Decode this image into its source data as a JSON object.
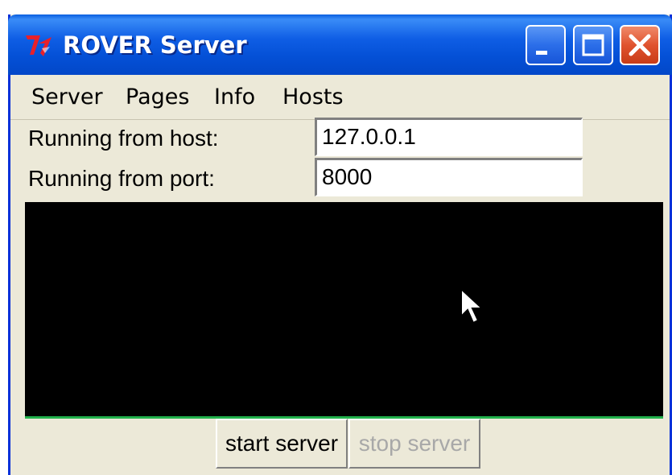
{
  "window": {
    "title": "ROVER Server",
    "icon": "tk-feather-icon",
    "controls": [
      "minimize-icon",
      "maximize-icon",
      "close-icon"
    ]
  },
  "menu": {
    "items": [
      "Server",
      "Pages",
      "Info",
      "Hosts"
    ]
  },
  "fields": {
    "host_label": "Running from host:",
    "host_value": "127.0.0.1",
    "port_label": "Running from port:",
    "port_value": "8000"
  },
  "buttons": {
    "start_label": "start server",
    "stop_label": "stop server",
    "stop_enabled": false
  },
  "colors": {
    "titlebar": "#0450d6",
    "console_bg": "#000000",
    "console_rule": "#22b14c",
    "disabled_text": "#a8a8a8"
  }
}
